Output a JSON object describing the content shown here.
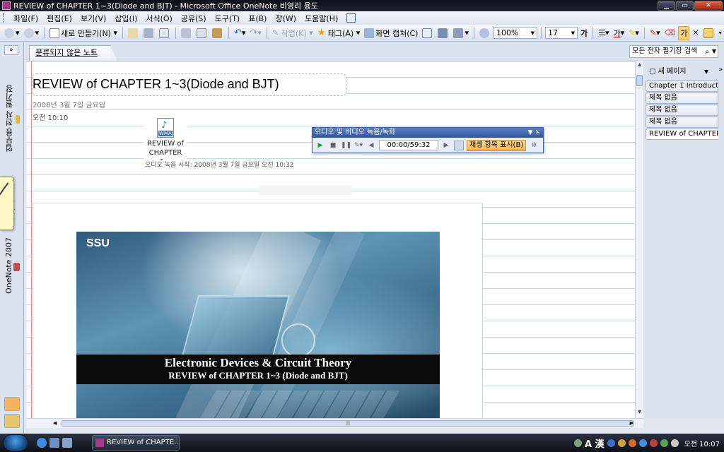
{
  "window": {
    "title": "REVIEW of CHAPTER 1~3(Diode and BJT) - Microsoft Office OneNote 비영리 용도",
    "controls": [
      "minimize",
      "maximize",
      "close"
    ]
  },
  "menu": {
    "items": [
      "파일(F)",
      "편집(E)",
      "보기(V)",
      "삽입(I)",
      "서식(O)",
      "공유(S)",
      "도구(T)",
      "표(B)",
      "창(W)",
      "도움말(H)"
    ]
  },
  "toolbar": {
    "new_label": "새로 만들기(N)",
    "pen_label": "작업(K)",
    "tag_label": "태그(A)",
    "screen_clip_label": "화면 캡처(C)",
    "zoom_value": "100%",
    "font_size_value": "17",
    "bold_label": "가",
    "highlight_label": "가"
  },
  "nav": {
    "collapse_label": "»",
    "notebooks": [
      {
        "label": "업무용 전자 필기장",
        "color": "#e8b43c"
      },
      {
        "label": "전자 필기장",
        "color": "#6f9f3d"
      },
      {
        "label": "OneNote 2007",
        "color": "#c74a4a"
      }
    ]
  },
  "section": {
    "tab_label": "분류되지 않은 노트",
    "search_placeholder": "모든 전자 필기장 검색"
  },
  "page": {
    "title": "REVIEW of CHAPTER 1~3(Diode and BJT)",
    "date": "2008년 3월 7일 금요일",
    "time": "오전 10:10",
    "audio_file_name": "REVIEW of CHAPTER 1...",
    "audio_caption": "오디오 녹음 시작: 2008년 3월 7일 금요일 오전 10:32",
    "audio_icon_tag": "WMA"
  },
  "slide": {
    "logo": "SSU",
    "line1": "Electronic Devices & Circuit Theory",
    "line2": "REVIEW of CHAPTER 1~3 (Diode and BJT)"
  },
  "audio_toolbar": {
    "title": "오디오 및 비디오 녹음/녹화",
    "time": "00:00/59:32",
    "show_playback_label": "재생 항목 표시(B)"
  },
  "page_tabs": {
    "new_page_label": "새 페이지",
    "tabs": [
      "Chapter 1 Introducti",
      "제목 없음",
      "제목 없음",
      "제목 없음",
      "REVIEW of CHAPTER"
    ],
    "active_index": 4
  },
  "taskbar": {
    "task_label": "REVIEW of CHAPTE...",
    "ime": "A 漢",
    "clock": "오전 10:07"
  }
}
